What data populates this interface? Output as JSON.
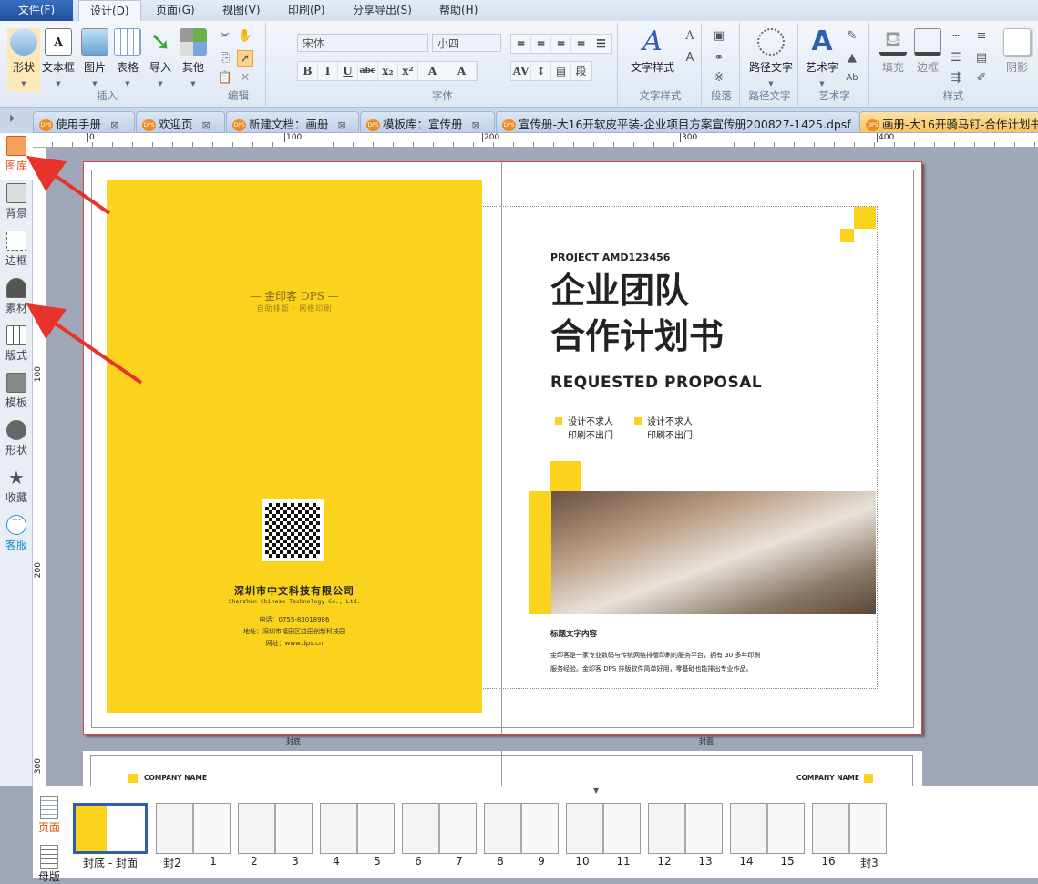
{
  "menu": [
    "文件(F)",
    "设计(D)",
    "页面(G)",
    "视图(V)",
    "印刷(P)",
    "分享导出(S)",
    "帮助(H)"
  ],
  "ribbon": {
    "insert": {
      "buttons": [
        "形状",
        "文本框",
        "图片",
        "表格",
        "导入",
        "其他"
      ],
      "label": "插入"
    },
    "edit": {
      "label": "编辑"
    },
    "font": {
      "family": "宋体",
      "size": "小四",
      "label": "字体",
      "format": [
        "B",
        "I",
        "U",
        "abc",
        "x₂",
        "x²",
        "A",
        "A"
      ]
    },
    "text_style": {
      "button": "文字样式",
      "label": "文字样式"
    },
    "paragraph": {
      "label": "段落",
      "button": "段"
    },
    "path_text": {
      "button": "路径文字",
      "label": "路径文字"
    },
    "art_text": {
      "button": "艺术字",
      "label": "艺术字"
    },
    "style": {
      "fill": "填充",
      "border": "边框",
      "shadow": "阴影",
      "label": "样式"
    }
  },
  "tabs": [
    "使用手册",
    "欢迎页",
    "新建文档：画册",
    "模板库：宣传册",
    "宣传册-大16开软皮平装-企业项目方案宣传册200827-1425.dpsf",
    "画册-大16开骑马钉-合作计划书"
  ],
  "ruler": [
    "0",
    "100",
    "200",
    "300",
    "400"
  ],
  "vruler": [
    "100",
    "200",
    "300"
  ],
  "sidebar": [
    "图库",
    "背景",
    "边框",
    "素材",
    "版式",
    "模板",
    "形状",
    "收藏",
    "客服"
  ],
  "back_cover": {
    "brand": "— 金印客 DPS —",
    "slogan": "自助排版 · 网络印刷",
    "company": "深圳市中文科技有限公司",
    "company_en": "Shenzhen Chinese Technology Co., Ltd.",
    "phone": "电话：0755-83018986",
    "address": "地址：深圳市福田区益田创新科技园",
    "website": "网址：www.dps.cn"
  },
  "front_cover": {
    "project": "PROJECT  AMD123456",
    "title1": "企业团队",
    "title2": "合作计划书",
    "subtitle": "REQUESTED  PROPOSAL",
    "bullets": [
      [
        "设计不求人",
        "印刷不出门"
      ],
      [
        "设计不求人",
        "印刷不出门"
      ]
    ],
    "heading": "标题文字内容",
    "body1": "金印客是一家专业数码与传统网络排版印刷的服务平台，拥有 30 多年印刷",
    "body2": "服务经验。金印客 DPS 排版软件简单好用，零基础也能排出专业作品。"
  },
  "page_labels": [
    "封底",
    "封面"
  ],
  "next_spread": {
    "left": "COMPANY NAME",
    "right": "COMPANY NAME"
  },
  "bottom_tabs": [
    "页面",
    "母版"
  ],
  "thumbnails": [
    [
      "封底 - 封面"
    ],
    [
      "封2",
      "1"
    ],
    [
      "2",
      "3"
    ],
    [
      "4",
      "5"
    ],
    [
      "6",
      "7"
    ],
    [
      "8",
      "9"
    ],
    [
      "10",
      "11"
    ],
    [
      "12",
      "13"
    ],
    [
      "14",
      "15"
    ],
    [
      "16",
      "封3"
    ]
  ],
  "colors": {
    "yellow": "#fbd21c",
    "accent_orange": "#e0541a"
  }
}
